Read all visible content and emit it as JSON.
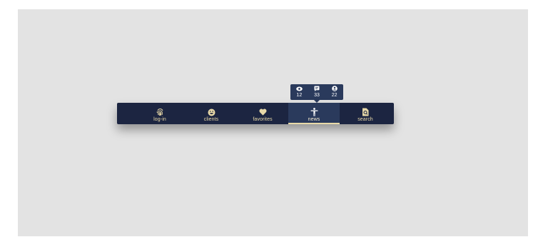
{
  "nav": {
    "items": [
      {
        "label": "log-in",
        "icon": "fingerprint-icon"
      },
      {
        "label": "clients",
        "icon": "smile-icon"
      },
      {
        "label": "favorites",
        "icon": "heart-icon"
      },
      {
        "label": "news",
        "icon": "accessibility-icon",
        "active": true
      },
      {
        "label": "search",
        "icon": "search-file-icon"
      }
    ]
  },
  "tooltip": {
    "stats": [
      {
        "icon": "eye-icon",
        "value": "12"
      },
      {
        "icon": "comment-icon",
        "value": "33"
      },
      {
        "icon": "user-icon",
        "value": "22"
      }
    ]
  },
  "colors": {
    "nav_background": "#1c2541",
    "active_background": "#2a3a5c",
    "accent": "#e8d9a8",
    "canvas": "#e3e3e3"
  }
}
